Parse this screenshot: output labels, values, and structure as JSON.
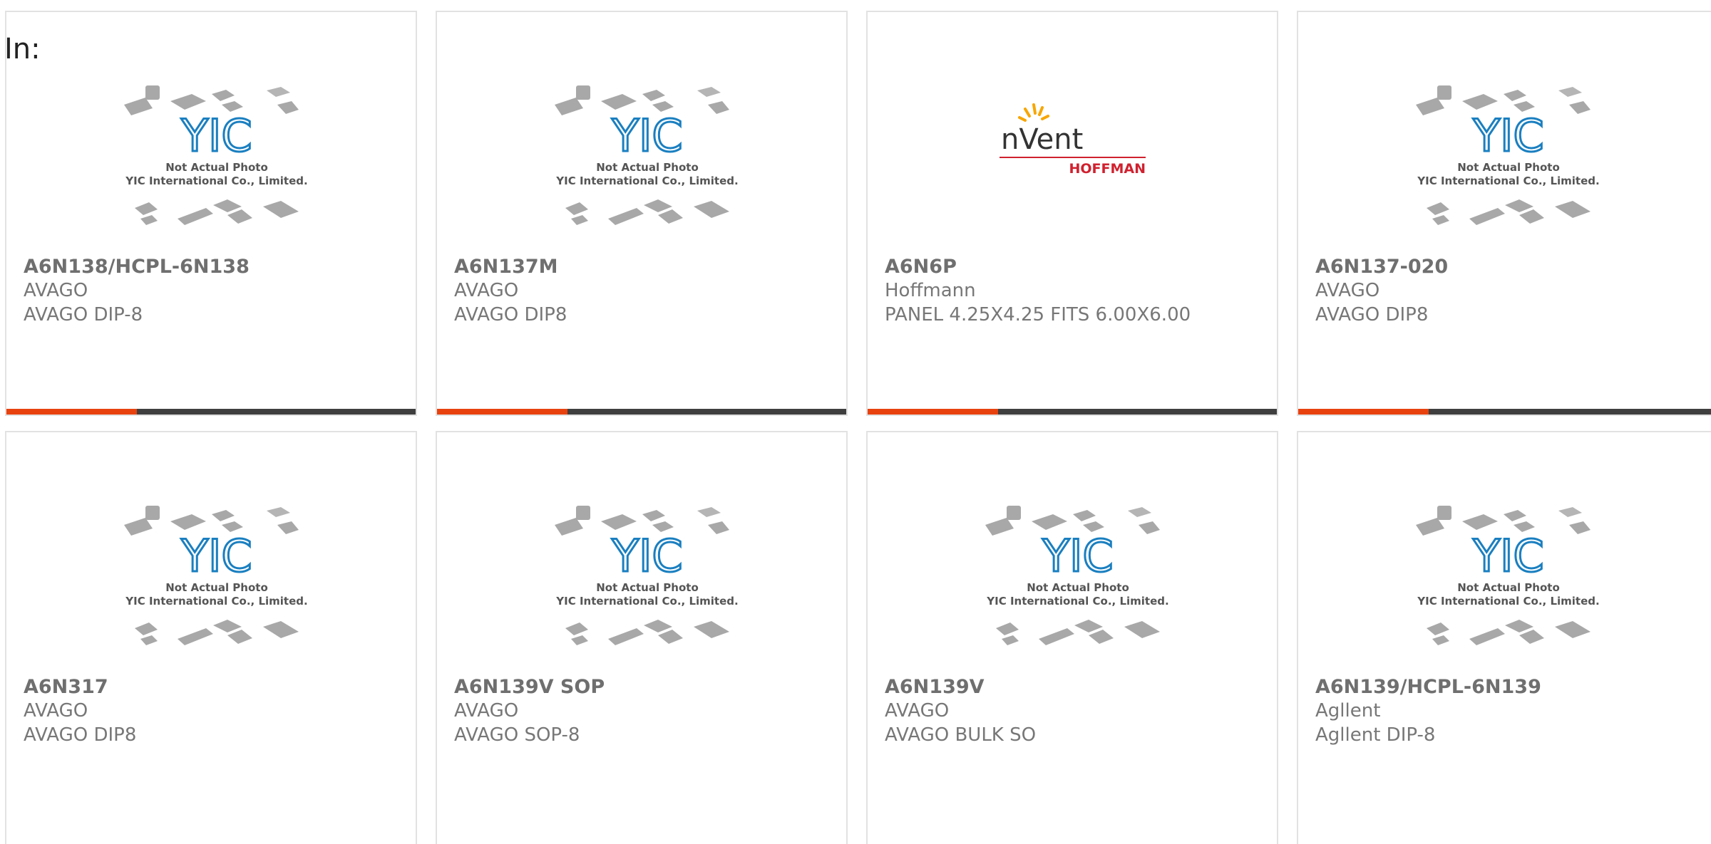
{
  "page": {
    "in_label": "In:"
  },
  "placeholder": {
    "brand_mark": "YIC",
    "line1": "Not Actual Photo",
    "line2": "YIC International Co., Limited."
  },
  "nvent": {
    "brand_mark": "nVent",
    "sub": "HOFFMAN"
  },
  "colors": {
    "accent": "#e8420f",
    "bar": "#3f3f3f",
    "yic_blue": "#1a7fc0",
    "nvent_red": "#d0212f",
    "nvent_yellow": "#f7a600"
  },
  "products": [
    {
      "title": "A6N138/HCPL-6N138",
      "brand": "AVAGO",
      "desc": "AVAGO DIP-8",
      "image": "yic-placeholder"
    },
    {
      "title": "A6N137M",
      "brand": "AVAGO",
      "desc": "AVAGO DIP8",
      "image": "yic-placeholder"
    },
    {
      "title": "A6N6P",
      "brand": "Hoffmann",
      "desc": "PANEL 4.25X4.25 FITS 6.00X6.00",
      "image": "nvent-logo"
    },
    {
      "title": "A6N137-020",
      "brand": "AVAGO",
      "desc": "AVAGO DIP8",
      "image": "yic-placeholder"
    },
    {
      "title": "A6N317",
      "brand": "AVAGO",
      "desc": "AVAGO DIP8",
      "image": "yic-placeholder"
    },
    {
      "title": "A6N139V SOP",
      "brand": "AVAGO",
      "desc": "AVAGO SOP-8",
      "image": "yic-placeholder"
    },
    {
      "title": "A6N139V",
      "brand": "AVAGO",
      "desc": "AVAGO BULK SO",
      "image": "yic-placeholder"
    },
    {
      "title": "A6N139/HCPL-6N139",
      "brand": "Agllent",
      "desc": "Agllent DIP-8",
      "image": "yic-placeholder"
    }
  ]
}
